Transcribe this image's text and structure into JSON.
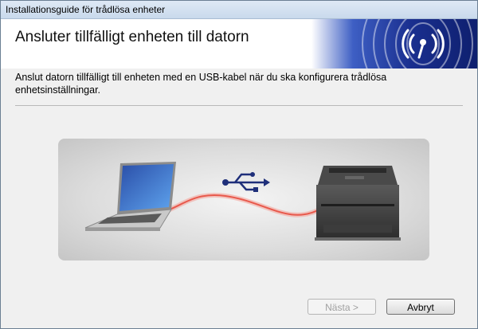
{
  "window": {
    "title": "Installationsguide för trådlösa enheter"
  },
  "header": {
    "title": "Ansluter tillfälligt enheten till datorn",
    "banner_icon": "wireless-signal-icon",
    "banner_color": "#1a2f8f"
  },
  "main": {
    "description": "Anslut datorn tillfälligt till enheten med en USB-kabel när du ska konfigurera trådlösa enhetsinställningar.",
    "illustration": {
      "left_device": "laptop-icon",
      "center_symbol": "usb-icon",
      "right_device": "printer-icon",
      "cable_color": "#e8594c"
    }
  },
  "footer": {
    "next_label": "Nästa >",
    "next_enabled": false,
    "cancel_label": "Avbryt"
  }
}
